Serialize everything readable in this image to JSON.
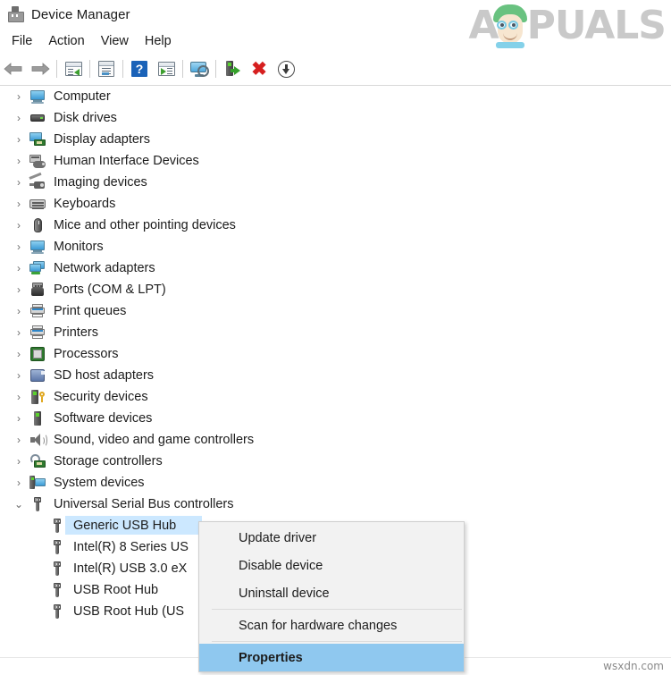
{
  "window": {
    "title": "Device Manager",
    "icon": "device-manager-icon"
  },
  "menubar": {
    "items": [
      {
        "label": "File"
      },
      {
        "label": "Action"
      },
      {
        "label": "View"
      },
      {
        "label": "Help"
      }
    ]
  },
  "toolbar": {
    "buttons": [
      {
        "name": "back-button",
        "icon": "left-arrow-icon",
        "label": "Back"
      },
      {
        "name": "forward-button",
        "icon": "right-arrow-icon",
        "label": "Forward"
      },
      {
        "name": "show-hide-console-tree-button",
        "icon": "console-tree-icon",
        "label": "Show/Hide Console Tree"
      },
      {
        "name": "properties-button",
        "icon": "properties-window-icon",
        "label": "Properties"
      },
      {
        "name": "help-button",
        "icon": "question-mark-icon",
        "label": "Help"
      },
      {
        "name": "show-hide-action-pane-button",
        "icon": "action-pane-icon",
        "label": "Show/Hide Action Pane"
      },
      {
        "name": "scan-for-hardware-changes-button",
        "icon": "monitor-magnifier-icon",
        "label": "Scan for hardware changes"
      },
      {
        "name": "update-driver-button",
        "icon": "device-update-icon",
        "label": "Update driver"
      },
      {
        "name": "uninstall-device-button",
        "icon": "red-x-icon",
        "label": "Uninstall device"
      },
      {
        "name": "disable-device-button",
        "icon": "down-arrow-circle-icon",
        "label": "Disable device"
      }
    ]
  },
  "tree": {
    "nodes": [
      {
        "label": "Computer",
        "icon": "computer-icon",
        "level": 1,
        "expanded": false,
        "chevron": "›",
        "selected": false
      },
      {
        "label": "Disk drives",
        "icon": "disk-drive-icon",
        "level": 1,
        "expanded": false,
        "chevron": "›",
        "selected": false
      },
      {
        "label": "Display adapters",
        "icon": "display-adapter-icon",
        "level": 1,
        "expanded": false,
        "chevron": "›",
        "selected": false
      },
      {
        "label": "Human Interface Devices",
        "icon": "hid-icon",
        "level": 1,
        "expanded": false,
        "chevron": "›",
        "selected": false
      },
      {
        "label": "Imaging devices",
        "icon": "imaging-device-icon",
        "level": 1,
        "expanded": false,
        "chevron": "›",
        "selected": false
      },
      {
        "label": "Keyboards",
        "icon": "keyboard-icon",
        "level": 1,
        "expanded": false,
        "chevron": "›",
        "selected": false
      },
      {
        "label": "Mice and other pointing devices",
        "icon": "mouse-icon",
        "level": 1,
        "expanded": false,
        "chevron": "›",
        "selected": false
      },
      {
        "label": "Monitors",
        "icon": "monitor-icon",
        "level": 1,
        "expanded": false,
        "chevron": "›",
        "selected": false
      },
      {
        "label": "Network adapters",
        "icon": "network-adapter-icon",
        "level": 1,
        "expanded": false,
        "chevron": "›",
        "selected": false
      },
      {
        "label": "Ports (COM & LPT)",
        "icon": "port-icon",
        "level": 1,
        "expanded": false,
        "chevron": "›",
        "selected": false
      },
      {
        "label": "Print queues",
        "icon": "printer-icon",
        "level": 1,
        "expanded": false,
        "chevron": "›",
        "selected": false
      },
      {
        "label": "Printers",
        "icon": "printer-icon",
        "level": 1,
        "expanded": false,
        "chevron": "›",
        "selected": false
      },
      {
        "label": "Processors",
        "icon": "processor-icon",
        "level": 1,
        "expanded": false,
        "chevron": "›",
        "selected": false
      },
      {
        "label": "SD host adapters",
        "icon": "sd-host-adapter-icon",
        "level": 1,
        "expanded": false,
        "chevron": "›",
        "selected": false
      },
      {
        "label": "Security devices",
        "icon": "security-device-icon",
        "level": 1,
        "expanded": false,
        "chevron": "›",
        "selected": false
      },
      {
        "label": "Software devices",
        "icon": "software-device-icon",
        "level": 1,
        "expanded": false,
        "chevron": "›",
        "selected": false
      },
      {
        "label": "Sound, video and game controllers",
        "icon": "sound-icon",
        "level": 1,
        "expanded": false,
        "chevron": "›",
        "selected": false
      },
      {
        "label": "Storage controllers",
        "icon": "storage-controller-icon",
        "level": 1,
        "expanded": false,
        "chevron": "›",
        "selected": false
      },
      {
        "label": "System devices",
        "icon": "system-device-icon",
        "level": 1,
        "expanded": false,
        "chevron": "›",
        "selected": false
      },
      {
        "label": "Universal Serial Bus controllers",
        "icon": "usb-icon",
        "level": 1,
        "expanded": true,
        "chevron": "⌄",
        "selected": false
      },
      {
        "label": "Generic USB Hub",
        "icon": "usb-icon",
        "level": 2,
        "expanded": false,
        "chevron": "",
        "selected": true
      },
      {
        "label": "Intel(R) 8 Series US",
        "icon": "usb-icon",
        "level": 2,
        "expanded": false,
        "chevron": "",
        "selected": false
      },
      {
        "label": "Intel(R) USB 3.0 eX",
        "icon": "usb-icon",
        "level": 2,
        "expanded": false,
        "chevron": "",
        "selected": false
      },
      {
        "label": "USB Root Hub",
        "icon": "usb-icon",
        "level": 2,
        "expanded": false,
        "chevron": "",
        "selected": false
      },
      {
        "label": "USB Root Hub (US",
        "icon": "usb-icon",
        "level": 2,
        "expanded": false,
        "chevron": "",
        "selected": false
      }
    ]
  },
  "context_menu": {
    "items": [
      {
        "type": "item",
        "label": "Update driver",
        "highlighted": false
      },
      {
        "type": "item",
        "label": "Disable device",
        "highlighted": false
      },
      {
        "type": "item",
        "label": "Uninstall device",
        "highlighted": false
      },
      {
        "type": "separator"
      },
      {
        "type": "item",
        "label": "Scan for hardware changes",
        "highlighted": false
      },
      {
        "type": "separator"
      },
      {
        "type": "item",
        "label": "Properties",
        "highlighted": true
      }
    ]
  },
  "watermarks": {
    "brand_a": "A",
    "brand_rest": "PUALS",
    "source": "wsxdn.com"
  },
  "colors": {
    "selection_blue": "#cce8ff",
    "menu_highlight_blue": "#8fc8ef",
    "menu_bg": "#f2f2f2",
    "window_bg": "#ffffff",
    "text": "#1c1c1c"
  }
}
